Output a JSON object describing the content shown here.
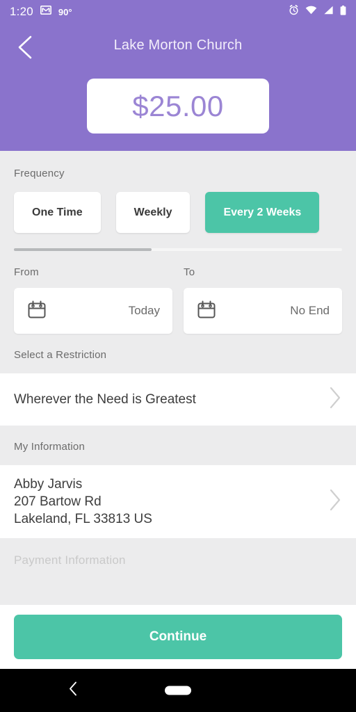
{
  "status_bar": {
    "time": "1:20",
    "temperature": "90°",
    "icons": [
      "mail-icon",
      "alarm-icon",
      "wifi-icon",
      "cell-signal-icon",
      "battery-icon"
    ]
  },
  "header": {
    "back_icon": "chevron-left-icon",
    "title": "Lake Morton Church",
    "amount": "$25.00",
    "background_color": "#8a73cc",
    "amount_color": "#9b85d4"
  },
  "frequency": {
    "label": "Frequency",
    "options": [
      {
        "label": "One Time",
        "selected": false
      },
      {
        "label": "Weekly",
        "selected": false
      },
      {
        "label": "Every 2 Weeks",
        "selected": true
      }
    ],
    "selected_color": "#4cc5a7",
    "scroll_position_percent": 42
  },
  "date_range": {
    "from_label": "From",
    "from_value": "Today",
    "to_label": "To",
    "to_value": "No End",
    "icon": "calendar-icon"
  },
  "restriction": {
    "section_label": "Select a Restriction",
    "value": "Wherever the Need is Greatest",
    "chevron": "chevron-right-icon"
  },
  "my_information": {
    "section_label": "My Information",
    "name": "Abby Jarvis",
    "street": "207 Bartow Rd",
    "city_state_zip": "Lakeland, FL 33813 US",
    "chevron": "chevron-right-icon"
  },
  "payment": {
    "section_label": "Payment Information"
  },
  "footer": {
    "continue_label": "Continue",
    "button_color": "#4cc5a7"
  },
  "navigation_bar": {
    "back_icon": "nav-back-icon",
    "home_icon": "nav-home-pill"
  }
}
